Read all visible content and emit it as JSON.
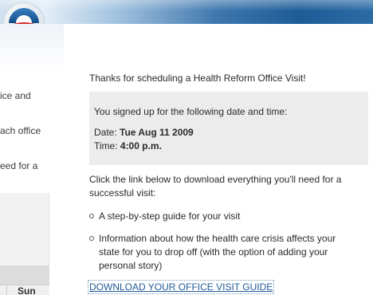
{
  "colors": {
    "link": "#1f5a98",
    "box_bg": "#ececec",
    "banner_blue": "#1e5c98"
  },
  "header": {
    "logo_icon": "obama-campaign-logo"
  },
  "left_pane": {
    "fragments": [
      "ice and",
      "ach office",
      "eed for a"
    ],
    "calendar_day_label": "Sun"
  },
  "main": {
    "thanks_text": "Thanks for scheduling a Health Reform Office Visit!",
    "confirmation": {
      "intro": "You signed up for the following date and time:",
      "date_label": "Date: ",
      "date_value": "Tue Aug 11 2009",
      "time_label": "Time: ",
      "time_value": "4:00 p.m."
    },
    "download_intro": "Click the link below to download everything you'll need for a successful visit:",
    "bullets": [
      "A step-by-step guide for your visit",
      "Information about how the health care crisis affects your state for you to drop off (with the option of adding your personal story)"
    ],
    "download_link": "DOWNLOAD YOUR OFFICE VISIT GUIDE"
  }
}
